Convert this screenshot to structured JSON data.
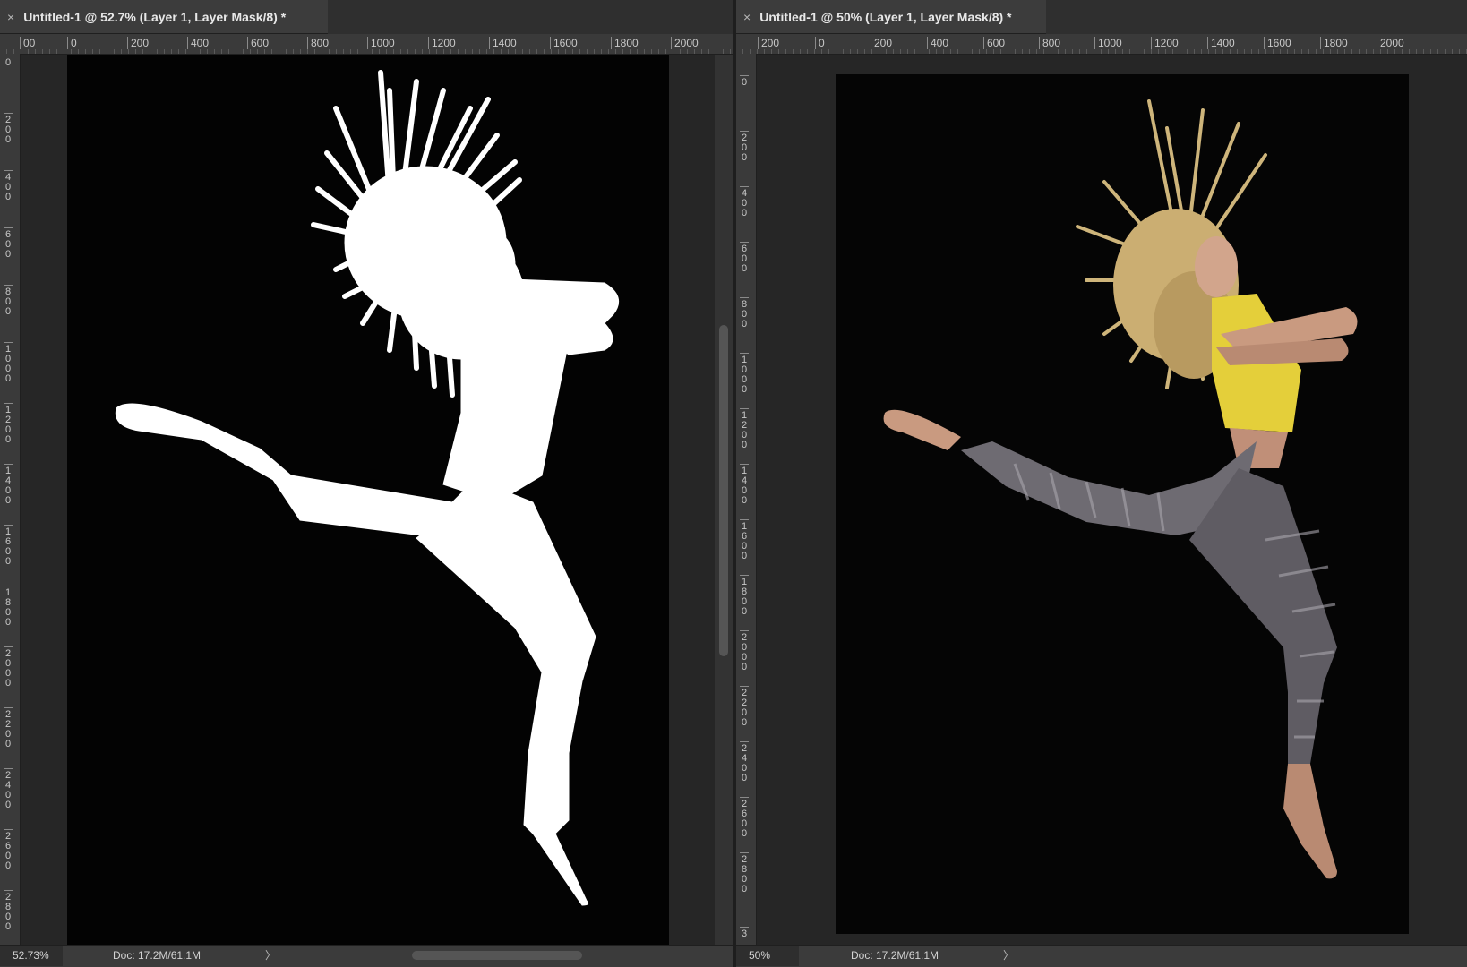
{
  "left_window": {
    "tab_title": "Untitled-1 @ 52.7% (Layer 1, Layer Mask/8) *",
    "close_glyph": "×",
    "ruler_h": [
      "00",
      "0",
      "200",
      "400",
      "600",
      "800",
      "1000",
      "1200",
      "1400",
      "1600",
      "1800",
      "2000"
    ],
    "ruler_v": [
      "0",
      "200",
      "400",
      "600",
      "800",
      "1000",
      "1200",
      "1400",
      "1600",
      "1800",
      "2000",
      "2200",
      "2400",
      "2600",
      "2800"
    ],
    "zoom": "52.73%",
    "doc_size": "Doc: 17.2M/61.1M",
    "status_arrow": "〉",
    "content": "layer-mask-silhouette"
  },
  "right_window": {
    "tab_title": "Untitled-1 @ 50% (Layer 1, Layer Mask/8) *",
    "close_glyph": "×",
    "ruler_h": [
      "200",
      "0",
      "200",
      "400",
      "600",
      "800",
      "1000",
      "1200",
      "1400",
      "1600",
      "1800",
      "2000"
    ],
    "ruler_v": [
      "0",
      "200",
      "400",
      "600",
      "800",
      "1000",
      "1200",
      "1400",
      "1600",
      "1800",
      "2000",
      "2200",
      "2400",
      "2600",
      "2800",
      "3"
    ],
    "zoom": "50%",
    "doc_size": "Doc: 17.2M/61.1M",
    "status_arrow": "〉",
    "content": "dancer-photo"
  },
  "colors": {
    "mask_fill": "#ffffff",
    "canvas_bg": "#030303",
    "top_color": "#e4cf3a",
    "hair_color": "#d9bf82",
    "legging_color": "#6e6b72",
    "skin_color": "#c99a80"
  }
}
